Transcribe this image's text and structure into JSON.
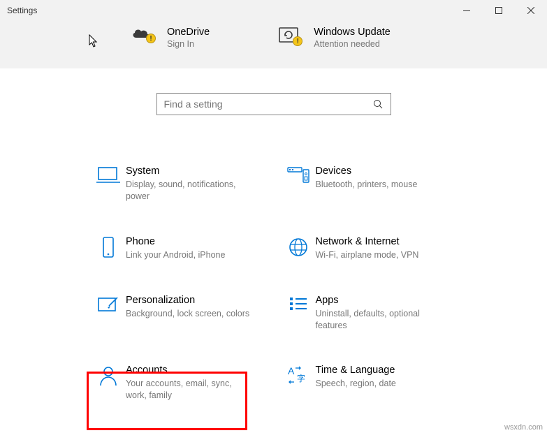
{
  "window": {
    "title": "Settings"
  },
  "header": {
    "onedrive": {
      "title": "OneDrive",
      "subtitle": "Sign In"
    },
    "update": {
      "title": "Windows Update",
      "subtitle": "Attention needed"
    }
  },
  "search": {
    "placeholder": "Find a setting"
  },
  "tiles": {
    "system": {
      "title": "System",
      "subtitle": "Display, sound, notifications, power"
    },
    "devices": {
      "title": "Devices",
      "subtitle": "Bluetooth, printers, mouse"
    },
    "phone": {
      "title": "Phone",
      "subtitle": "Link your Android, iPhone"
    },
    "network": {
      "title": "Network & Internet",
      "subtitle": "Wi-Fi, airplane mode, VPN"
    },
    "personal": {
      "title": "Personalization",
      "subtitle": "Background, lock screen, colors"
    },
    "apps": {
      "title": "Apps",
      "subtitle": "Uninstall, defaults, optional features"
    },
    "accounts": {
      "title": "Accounts",
      "subtitle": "Your accounts, email, sync, work, family"
    },
    "time": {
      "title": "Time & Language",
      "subtitle": "Speech, region, date"
    }
  },
  "watermark": "wsxdn.com"
}
